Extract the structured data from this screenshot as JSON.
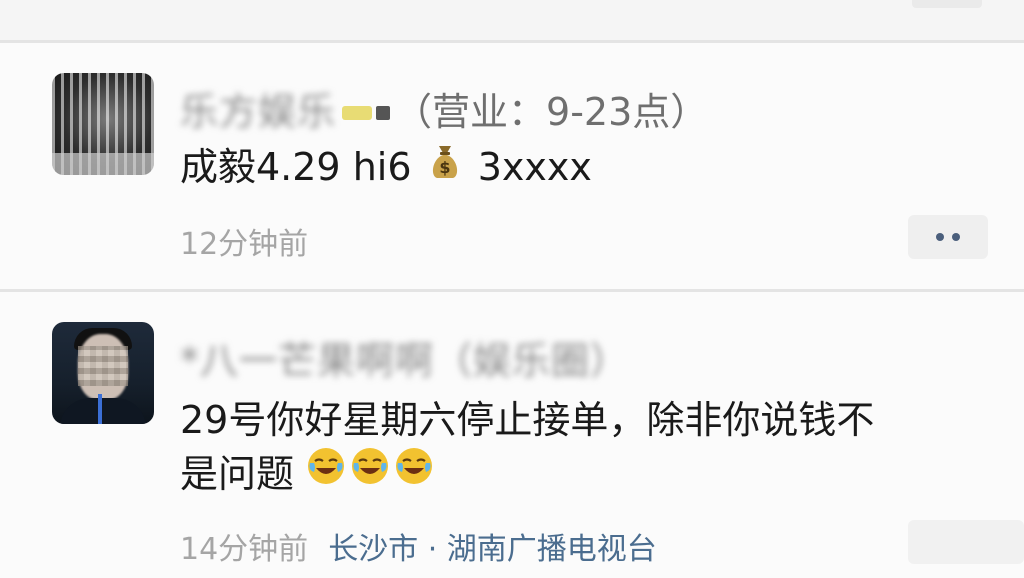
{
  "posts": [
    {
      "nickname_blurred": "乐方娱乐",
      "nickname_suffix": "（营业：9-23点）",
      "content_prefix": "成毅4.29 hi6",
      "content_suffix": "3xxxx",
      "content_icon": "moneybag-icon",
      "time": "12分钟前",
      "location": ""
    },
    {
      "nickname_blurred": "*八一芒果啊啊（娱乐圈）",
      "content_line1": "29号你好星期六停止接单，除非你说钱不",
      "content_line2": "是问题",
      "content_icons": [
        "laughing-crying-icon",
        "laughing-crying-icon",
        "laughing-crying-icon"
      ],
      "time": "14分钟前",
      "location": "长沙市 · 湖南广播电视台"
    }
  ],
  "colors": {
    "location_link": "#4b6d8f",
    "timestamp": "#a5a5a5",
    "more_dots": "#4b5f7c"
  }
}
